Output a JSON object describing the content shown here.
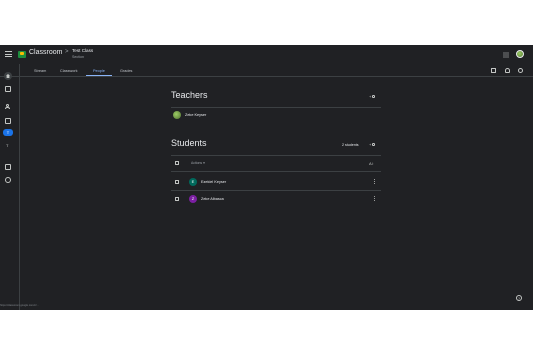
{
  "header": {
    "app_name": "Classroom",
    "breadcrumb_sep": ">",
    "class_name": "Test Class",
    "class_section": "Section"
  },
  "tabs": [
    {
      "label": "Stream"
    },
    {
      "label": "Classwork"
    },
    {
      "label": "People",
      "active": true
    },
    {
      "label": "Grades"
    }
  ],
  "rail": {
    "class_initial": "T",
    "item_initial": "T"
  },
  "teachers": {
    "title": "Teachers",
    "items": [
      {
        "name": "Zeke Keyser",
        "avatar_initial": ""
      }
    ]
  },
  "students": {
    "title": "Students",
    "count_label": "2 students",
    "actions_label": "Actions",
    "items": [
      {
        "name": "Ezekiel Keyser",
        "avatar_initial": "E",
        "avatar_color": "#00695c"
      },
      {
        "name": "Zeke Albasca",
        "avatar_initial": "Z",
        "avatar_color": "#7b1fa2"
      }
    ]
  },
  "status_url": "https://classroom.google.com/c/..."
}
